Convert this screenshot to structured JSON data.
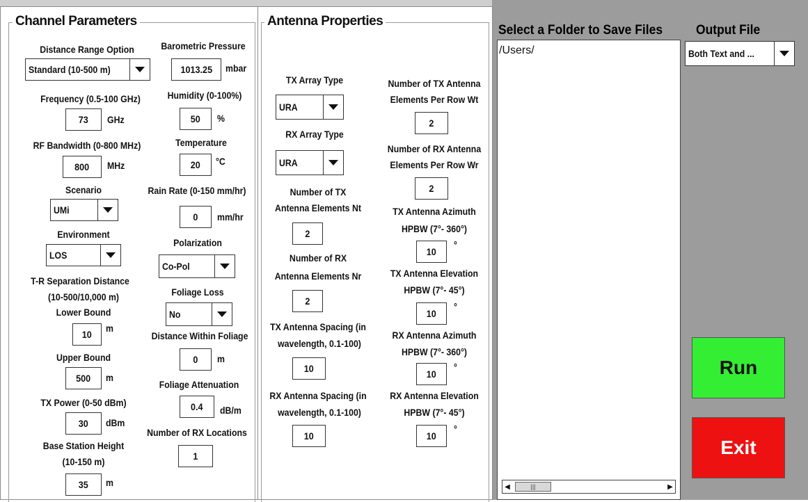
{
  "channel": {
    "title": "Channel Parameters",
    "distance_range_label": "Distance Range Option",
    "distance_range_value": "Standard (10-500 m)",
    "frequency_label": "Frequency (0.5-100 GHz)",
    "frequency_value": "73",
    "frequency_unit": "GHz",
    "bandwidth_label": "RF Bandwidth (0-800 MHz)",
    "bandwidth_value": "800",
    "bandwidth_unit": "MHz",
    "scenario_label": "Scenario",
    "scenario_value": "UMi",
    "environment_label": "Environment",
    "environment_value": "LOS",
    "tr_sep_label_1": "T-R Separation Distance",
    "tr_sep_label_2": "(10-500/10,000 m)",
    "lower_bound_label": "Lower Bound",
    "lower_bound_value": "10",
    "lower_bound_unit": "m",
    "upper_bound_label": "Upper Bound",
    "upper_bound_value": "500",
    "upper_bound_unit": "m",
    "tx_power_label": "TX Power (0-50 dBm)",
    "tx_power_value": "30",
    "tx_power_unit": "dBm",
    "bs_height_label_1": "Base Station Height",
    "bs_height_label_2": "(10-150 m)",
    "bs_height_value": "35",
    "bs_height_unit": "m",
    "pressure_label": "Barometric Pressure",
    "pressure_value": "1013.25",
    "pressure_unit": "mbar",
    "humidity_label": "Humidity (0-100%)",
    "humidity_value": "50",
    "humidity_unit": "%",
    "temperature_label": "Temperature",
    "temperature_value": "20",
    "temperature_unit": "°C",
    "rain_label": "Rain Rate (0-150 mm/hr)",
    "rain_value": "0",
    "rain_unit": "mm/hr",
    "polarization_label": "Polarization",
    "polarization_value": "Co-Pol",
    "foliage_loss_label": "Foliage Loss",
    "foliage_loss_value": "No",
    "dist_foliage_label": "Distance Within Foliage",
    "dist_foliage_value": "0",
    "dist_foliage_unit": "m",
    "foliage_att_label": "Foliage Attenuation",
    "foliage_att_value": "0.4",
    "foliage_att_unit": "dB/m",
    "rx_locations_label": "Number of RX Locations",
    "rx_locations_value": "1"
  },
  "antenna": {
    "title": "Antenna Properties",
    "tx_array_label": "TX Array Type",
    "tx_array_value": "URA",
    "rx_array_label": "RX Array Type",
    "rx_array_value": "URA",
    "nt_label_1": "Number of TX",
    "nt_label_2": "Antenna Elements Nt",
    "nt_value": "2",
    "nr_label_1": "Number of RX",
    "nr_label_2": "Antenna Elements Nr",
    "nr_value": "2",
    "tx_spacing_label_1": "TX Antenna Spacing (in",
    "tx_spacing_label_2": "wavelength, 0.1-100)",
    "tx_spacing_value": "10",
    "rx_spacing_label_1": "RX Antenna Spacing (in",
    "rx_spacing_label_2": "wavelength, 0.1-100)",
    "rx_spacing_value": "10",
    "wt_label_1": "Number of TX Antenna",
    "wt_label_2": "Elements Per Row Wt",
    "wt_value": "2",
    "wr_label_1": "Number of RX Antenna",
    "wr_label_2": "Elements Per Row Wr",
    "wr_value": "2",
    "tx_az_label_1": "TX Antenna Azimuth",
    "tx_az_label_2": "HPBW (7°- 360°)",
    "tx_az_value": "10",
    "tx_el_label_1": "TX Antenna Elevation",
    "tx_el_label_2": "HPBW (7°- 45°)",
    "tx_el_value": "10",
    "rx_az_label_1": "RX Antenna Azimuth",
    "rx_az_label_2": "HPBW (7°- 360°)",
    "rx_az_value": "10",
    "rx_el_label_1": "RX Antenna Elevation",
    "rx_el_label_2": "HPBW (7°- 45°)",
    "rx_el_value": "10",
    "degree_unit": "°"
  },
  "folder": {
    "title": "Select a Folder to Save Files",
    "path": "/Users/"
  },
  "output": {
    "title": "Output File",
    "value": "Both Text and ..."
  },
  "buttons": {
    "run": "Run",
    "exit": "Exit"
  },
  "colors": {
    "run": "#33ee33",
    "exit": "#ee1111",
    "background_gray": "#9c9c9c"
  },
  "icons": {
    "dropdown": "chevron-down-icon",
    "scroll_left": "arrow-left-icon",
    "scroll_right": "arrow-right-icon"
  }
}
